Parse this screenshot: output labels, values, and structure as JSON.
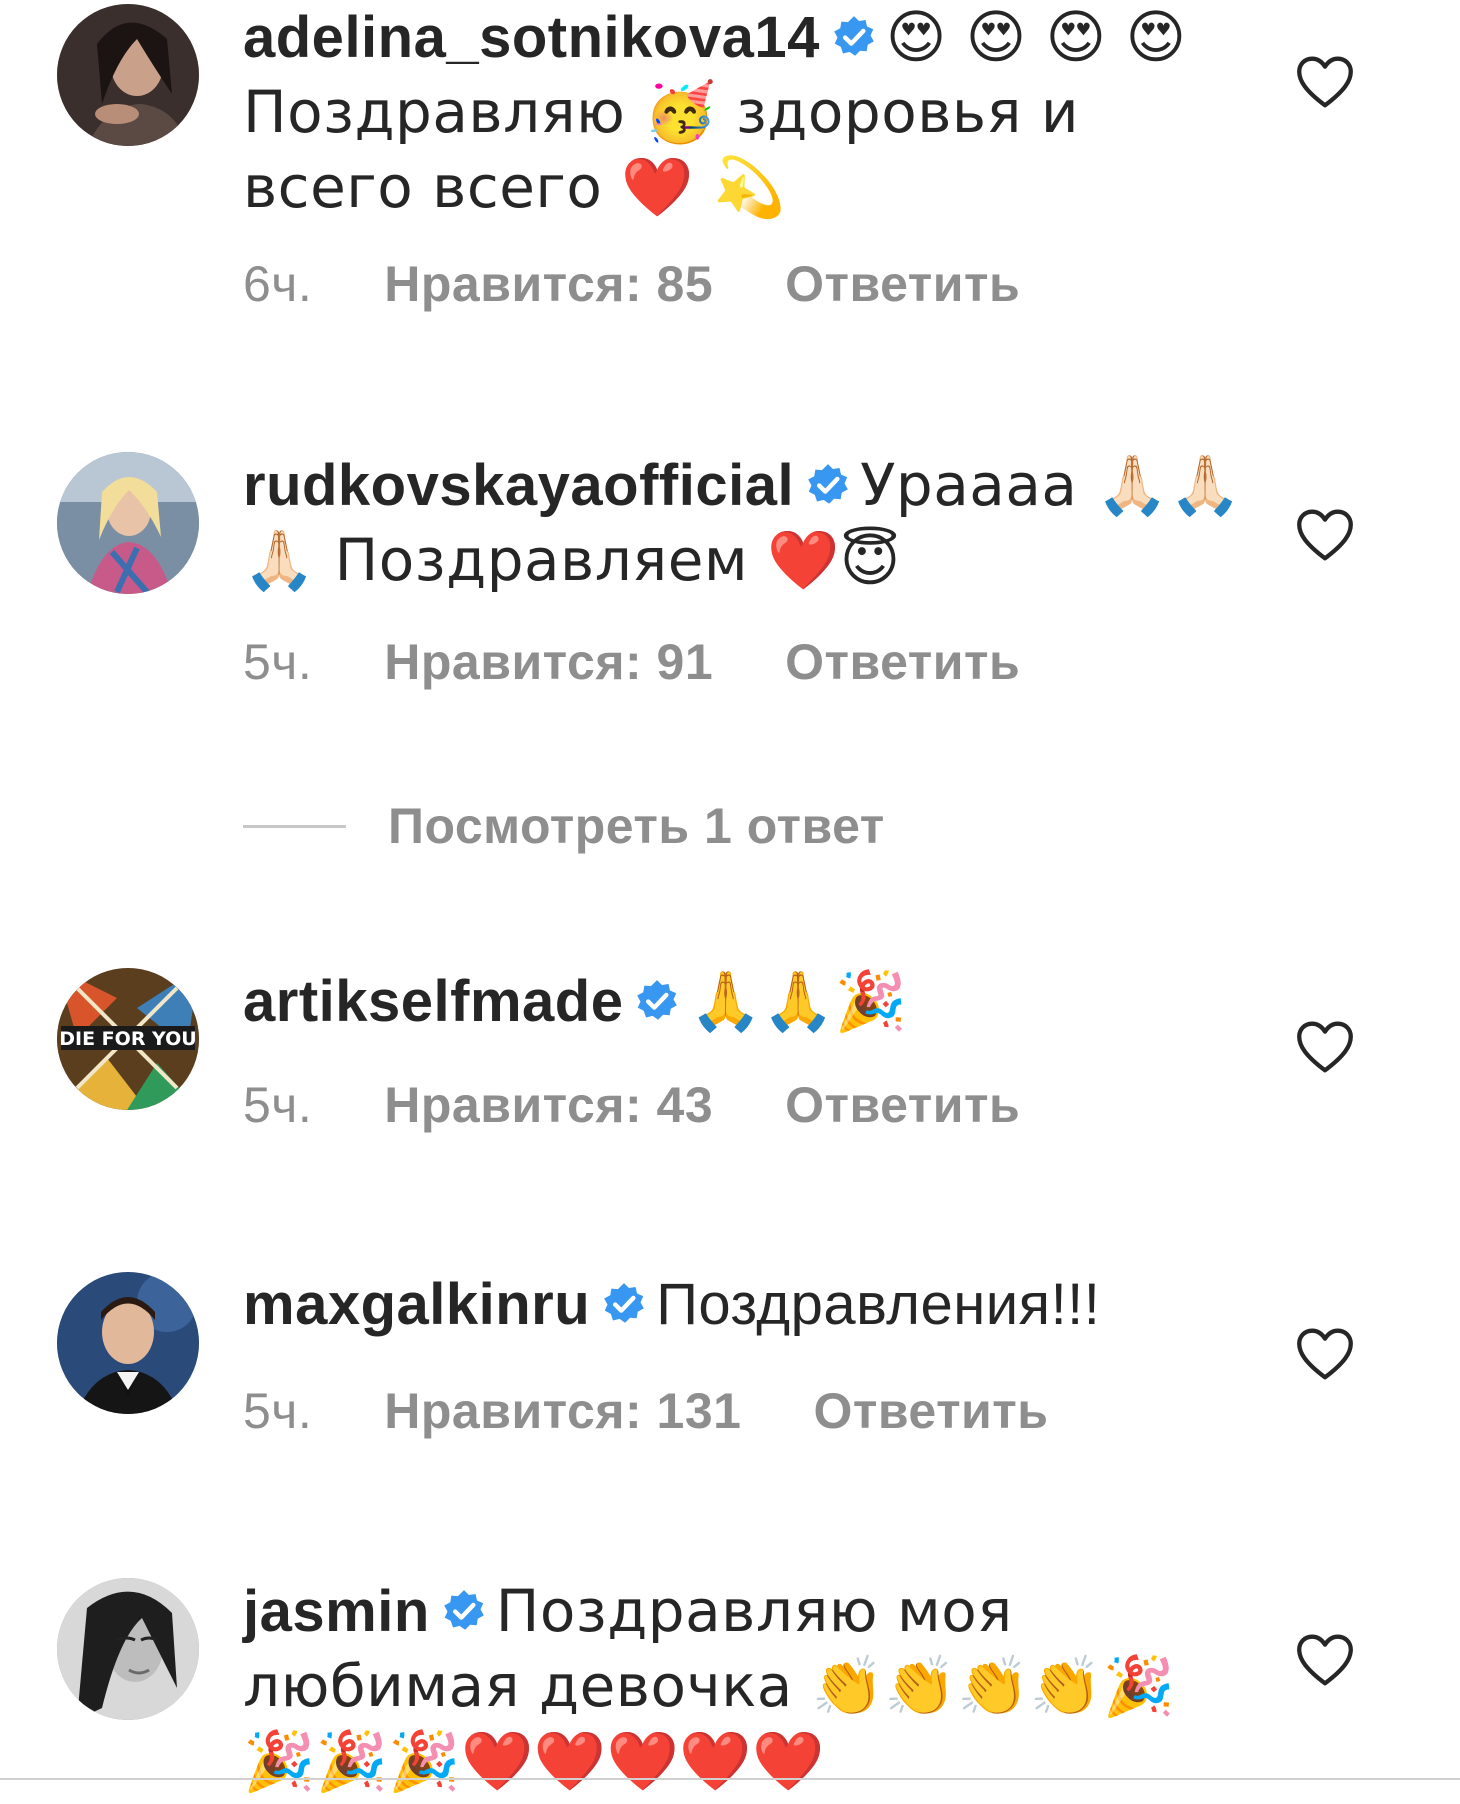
{
  "comments": [
    {
      "username": "adelina_sotnikova14",
      "text": "😍 😍 😍 😍 Поздравляю 🥳 здоровья и всего всего ❤️ 💫",
      "time": "6ч.",
      "likes": "Нравится: 85",
      "reply": "Ответить",
      "avatar_icon": "avatar-woman-dark-hair"
    },
    {
      "username": "rudkovskayaofficial",
      "text": "Урaaaa 🙏🏻🙏🏻🙏🏻 Поздравляем ❤️😇",
      "time": "5ч.",
      "likes": "Нравится: 91",
      "reply": "Ответить",
      "avatar_icon": "avatar-woman-blonde"
    },
    {
      "username": "artikselfmade",
      "text": "🙏🙏🎉",
      "time": "5ч.",
      "likes": "Нравится: 43",
      "reply": "Ответить",
      "avatar_icon": "avatar-die-for-you-logo",
      "avatar_text": "DIE FOR YOU"
    },
    {
      "username": "maxgalkinru",
      "text": "Поздравления!!!",
      "time": "5ч.",
      "likes": "Нравится: 131",
      "reply": "Ответить",
      "avatar_icon": "avatar-man-suit"
    },
    {
      "username": "jasmin",
      "text": "Поздравляю моя любимая девочка 👏👏👏👏🎉🎉🎉🎉❤️❤️❤️❤️❤️",
      "avatar_icon": "avatar-woman-bw"
    }
  ],
  "view_replies": "Посмотреть 1 ответ",
  "colors": {
    "text": "#262626",
    "meta": "#8e8e8e",
    "verified": "#3897f0",
    "divider": "#c7c7c7"
  }
}
